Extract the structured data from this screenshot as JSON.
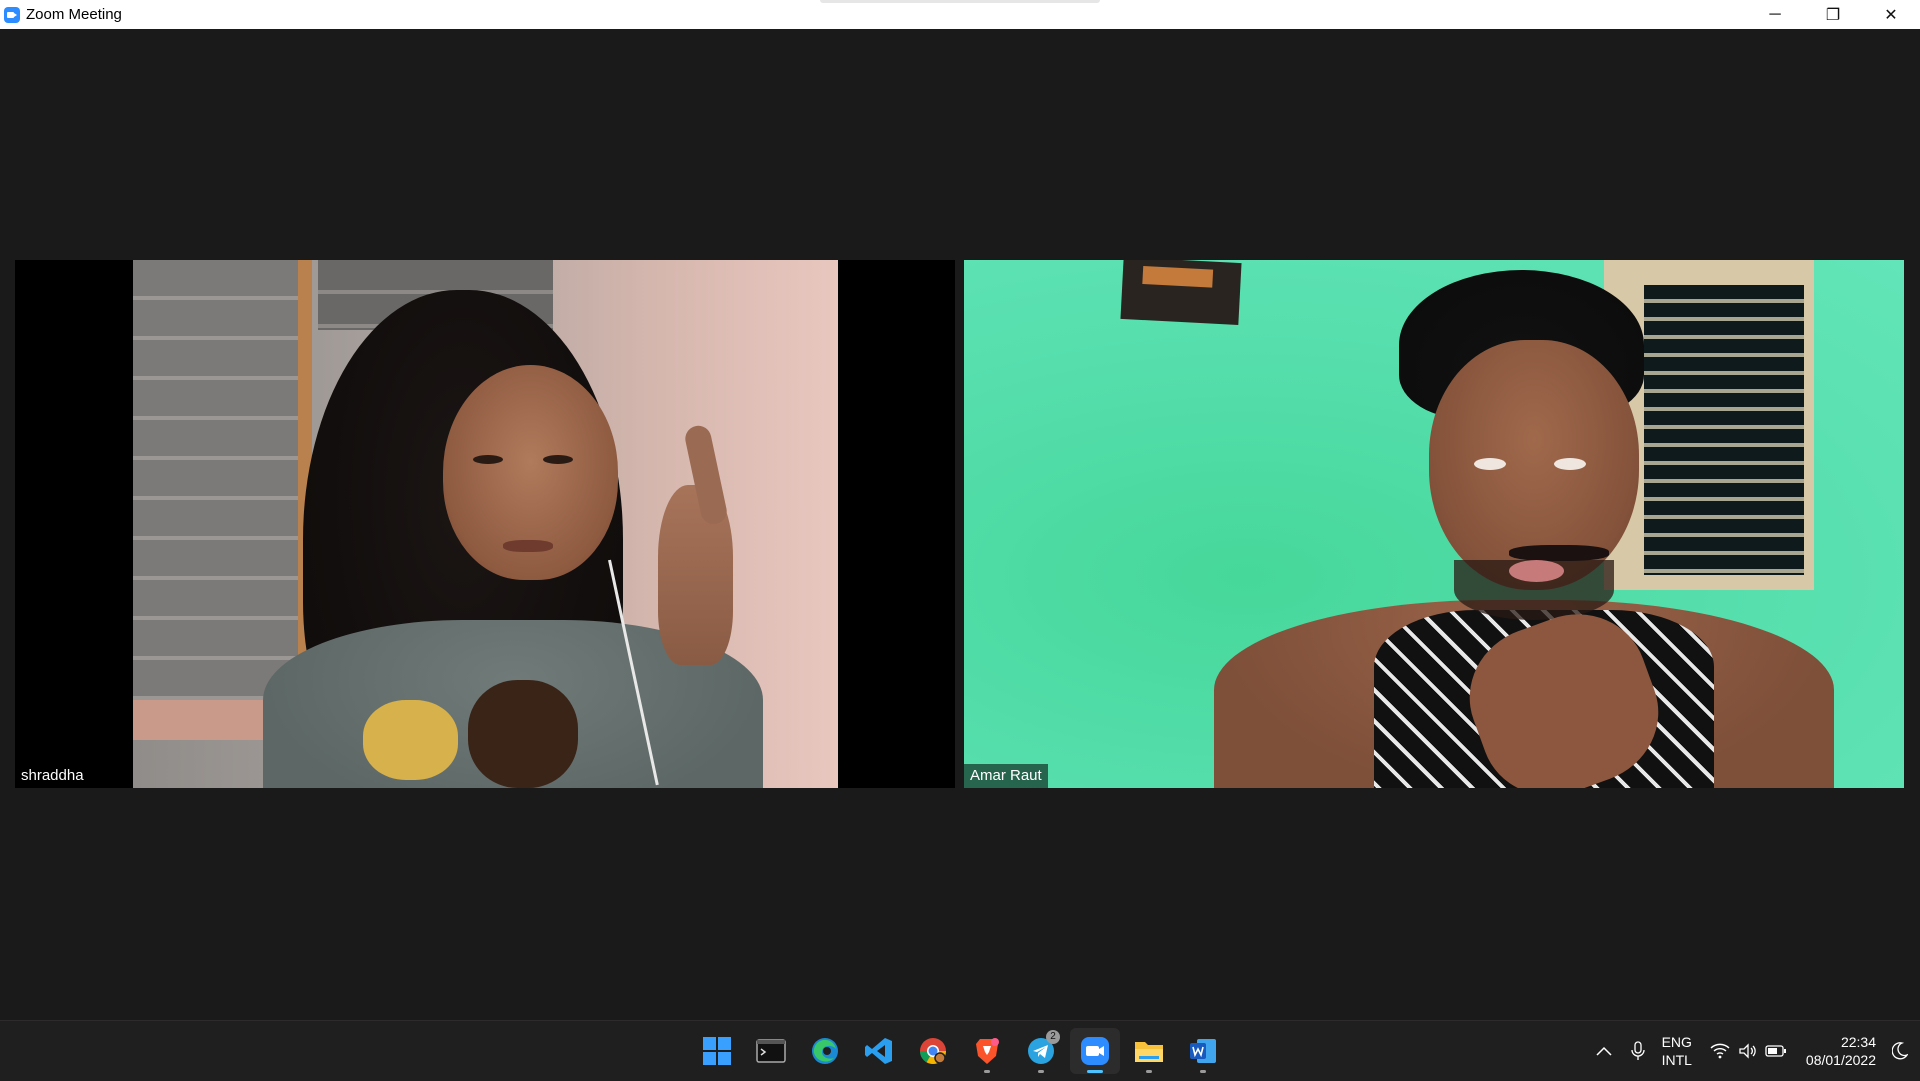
{
  "window": {
    "title": "Zoom Meeting",
    "controls": {
      "minimize": "─",
      "restore": "❐",
      "close": "✕"
    }
  },
  "participants": [
    {
      "name": "shraddha"
    },
    {
      "name": "Amar Raut"
    }
  ],
  "taskbar": {
    "apps": [
      {
        "name": "start",
        "icon": "windows-start-icon"
      },
      {
        "name": "terminal",
        "icon": "terminal-icon"
      },
      {
        "name": "edge",
        "icon": "edge-icon"
      },
      {
        "name": "vscode",
        "icon": "vscode-icon"
      },
      {
        "name": "chrome",
        "icon": "chrome-icon"
      },
      {
        "name": "brave",
        "icon": "brave-icon"
      },
      {
        "name": "telegram",
        "icon": "telegram-icon",
        "badge": "2"
      },
      {
        "name": "zoom",
        "icon": "zoom-icon"
      },
      {
        "name": "file-explorer",
        "icon": "folder-icon"
      },
      {
        "name": "word",
        "icon": "word-icon"
      }
    ],
    "tray": {
      "lang_line1": "ENG",
      "lang_line2": "INTL",
      "time": "22:34",
      "date": "08/01/2022"
    }
  },
  "colors": {
    "background": "#1a1a1a",
    "taskbar": "#201f1f",
    "accent": "#4cc2ff",
    "zoom_blue": "#2d8cff"
  }
}
